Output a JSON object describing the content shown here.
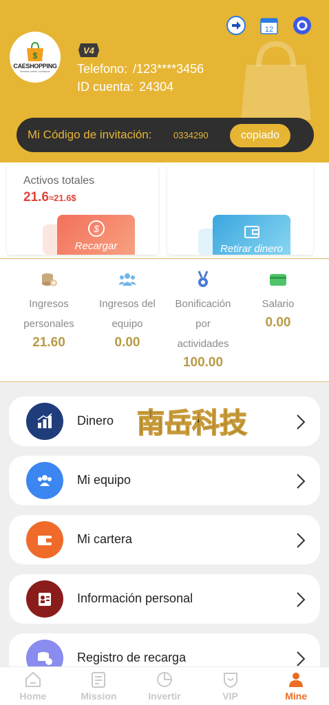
{
  "header": {
    "brand_name": "CAESHOPPING",
    "brand_tagline": "tiendas online confianza",
    "vip_level": "V4",
    "phone_label": "Telefono:",
    "phone_value": "/123****3456",
    "id_label": "ID cuenta:",
    "id_value": "24304",
    "calendar_day": "12"
  },
  "invite": {
    "label": "Mi Código de invitación:",
    "code": "0334290",
    "copy_label": "copiado"
  },
  "assets": {
    "title": "Activos totales",
    "value": "21.6",
    "approx": "≈21.6$",
    "recharge_label": "Recargar",
    "withdraw_label": "Retirar dinero"
  },
  "stats": [
    {
      "label_lines": [
        "Ingresos",
        "personales"
      ],
      "value": "21.60",
      "icon": "coins-icon"
    },
    {
      "label_lines": [
        "Ingresos del",
        "equipo"
      ],
      "value": "0.00",
      "icon": "team-icon"
    },
    {
      "label_lines": [
        "Bonificación",
        "por",
        "actividades"
      ],
      "value": "100.00",
      "icon": "medal-icon"
    },
    {
      "label_lines": [
        "Salario"
      ],
      "value": "0.00",
      "icon": "wallet-card-icon"
    }
  ],
  "menu": [
    {
      "label": "Dinero",
      "icon": "chart-icon",
      "color": "#1f3d7a"
    },
    {
      "label": "Mi equipo",
      "icon": "users-icon",
      "color": "#3b86f0"
    },
    {
      "label": "Mi cartera",
      "icon": "wallet-icon",
      "color": "#f06a2a"
    },
    {
      "label": "Información personal",
      "icon": "id-card-icon",
      "color": "#8a1c1c"
    },
    {
      "label": "Registro de recarga",
      "icon": "coin-stack-icon",
      "color": "#8b8cf0"
    }
  ],
  "watermark_text": "南岳科技",
  "tabs": [
    {
      "label": "Home",
      "icon": "home-icon",
      "active": false
    },
    {
      "label": "Mission",
      "icon": "clipboard-icon",
      "active": false
    },
    {
      "label": "Invertir",
      "icon": "pie-chart-icon",
      "active": false
    },
    {
      "label": "VIP",
      "icon": "vip-shield-icon",
      "active": false
    },
    {
      "label": "Mine",
      "icon": "person-icon",
      "active": true
    }
  ],
  "colors": {
    "header_bg": "#e6b534",
    "accent_red": "#e0443a",
    "stat_value": "#b79b46",
    "active_tab": "#ec6d24"
  }
}
